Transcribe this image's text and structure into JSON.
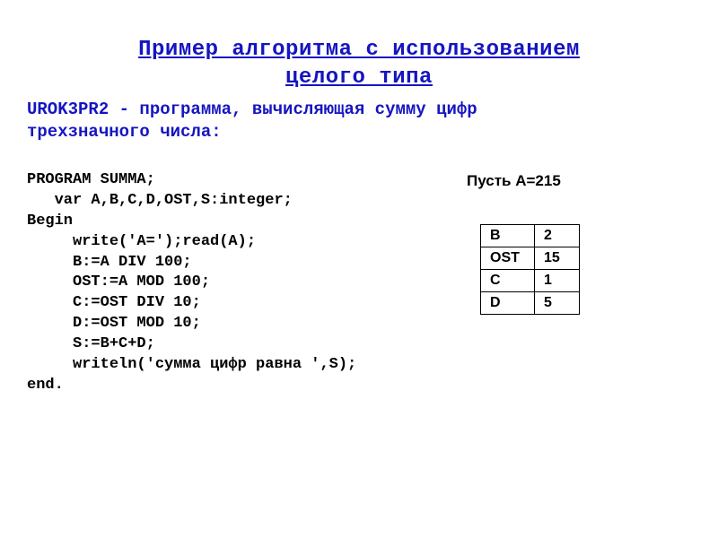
{
  "title_line1": "Пример алгоритма с использованием",
  "title_line2": "целого типа",
  "subtitle_line1": "UROK3PR2 - программа, вычисляющая сумму цифр",
  "subtitle_line2": "трехзначного числа:",
  "code": {
    "l1": "PROGRAM SUMMA;",
    "l2": "   var A,B,C,D,OST,S:integer;",
    "l3": "Begin",
    "l4": "     write('A=');read(A);",
    "l5": "     B:=A DIV 100;",
    "l6": "     OST:=A MOD 100;",
    "l7": "     C:=OST DIV 10;",
    "l8": "     D:=OST MOD 10;",
    "l9": "     S:=B+C+D;",
    "l10": "     writeln('сумма цифр равна ',S);",
    "l11": "end."
  },
  "example_label": "Пусть A=215",
  "trace": [
    {
      "var": "B",
      "val": "2"
    },
    {
      "var": "OST",
      "val": "15"
    },
    {
      "var": "C",
      "val": "1"
    },
    {
      "var": "D",
      "val": "5"
    }
  ]
}
